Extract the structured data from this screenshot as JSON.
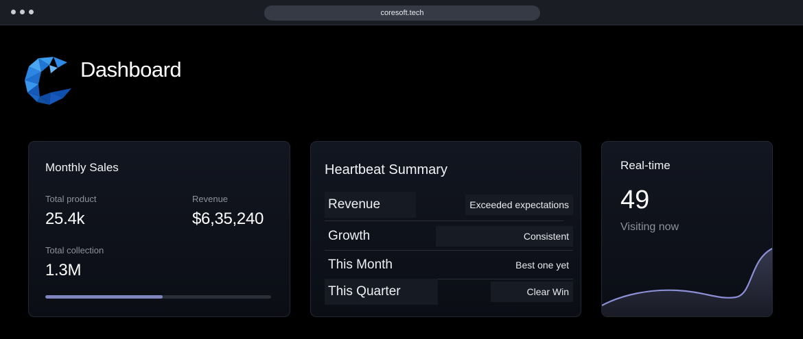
{
  "browser": {
    "url": "coresoft.tech"
  },
  "header": {
    "title": "Dashboard"
  },
  "monthly_sales": {
    "title": "Monthly Sales",
    "total_product_label": "Total product",
    "total_product_value": "25.4k",
    "revenue_label": "Revenue",
    "revenue_value": "$6,35,240",
    "total_collection_label": "Total collection",
    "total_collection_value": "1.3M",
    "progress_fraction": 0.52
  },
  "heartbeat": {
    "title": "Heartbeat Summary",
    "rows": [
      {
        "label": "Revenue",
        "value": "Exceeded expectations"
      },
      {
        "label": "Growth",
        "value": "Consistent"
      },
      {
        "label": "This Month",
        "value": "Best one yet"
      },
      {
        "label": "This Quarter",
        "value": "Clear Win"
      }
    ]
  },
  "realtime": {
    "title": "Real-time",
    "value": "49",
    "label": "Visiting now"
  },
  "colors": {
    "accent": "#7f84bf",
    "logo_blue": "#1a6fd6",
    "background": "#000000"
  }
}
